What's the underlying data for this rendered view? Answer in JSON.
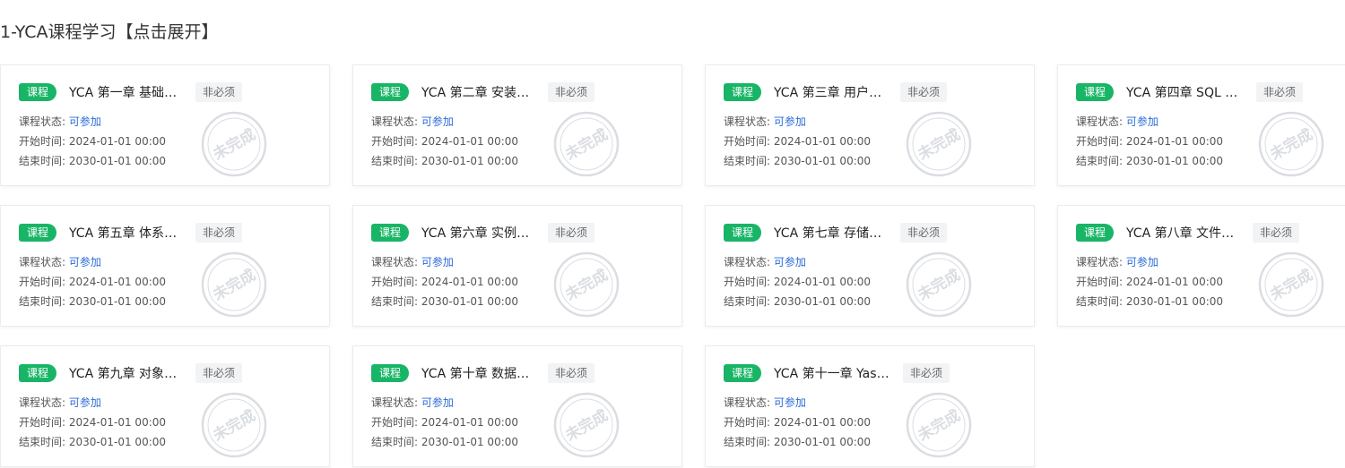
{
  "section": {
    "title": "1-YCA课程学习【点击展开】"
  },
  "labels": {
    "course_tag": "课程",
    "optional_tag": "非必须",
    "status_label": "课程状态:",
    "status_value": "可参加",
    "start_label": "开始时间:",
    "end_label": "结束时间:",
    "stamp_text": "未完成"
  },
  "colors": {
    "course_tag_bg": "#18b566",
    "status_value": "#2a6ad8",
    "stamp": "#dadde2"
  },
  "cards": [
    {
      "title": "YCA 第一章 基础介绍",
      "start": "2024-01-01 00:00",
      "end": "2030-01-01 00:00"
    },
    {
      "title": "YCA 第二章 安装部署",
      "start": "2024-01-01 00:00",
      "end": "2030-01-01 00:00"
    },
    {
      "title": "YCA 第三章 用户管理",
      "start": "2024-01-01 00:00",
      "end": "2030-01-01 00:00"
    },
    {
      "title": "YCA 第四章 SQL 语…",
      "start": "2024-01-01 00:00",
      "end": "2030-01-01 00:00"
    },
    {
      "title": "YCA 第五章 体系结构",
      "start": "2024-01-01 00:00",
      "end": "2030-01-01 00:00"
    },
    {
      "title": "YCA 第六章 实例管理",
      "start": "2024-01-01 00:00",
      "end": "2030-01-01 00:00"
    },
    {
      "title": "YCA 第七章 存储管理",
      "start": "2024-01-01 00:00",
      "end": "2030-01-01 00:00"
    },
    {
      "title": "YCA 第八章 文件管理",
      "start": "2024-01-01 00:00",
      "end": "2030-01-01 00:00"
    },
    {
      "title": "YCA 第九章 对象管理",
      "start": "2024-01-01 00:00",
      "end": "2030-01-01 00:00"
    },
    {
      "title": "YCA 第十章 数据字…",
      "start": "2024-01-01 00:00",
      "end": "2030-01-01 00:00"
    },
    {
      "title": "YCA 第十一章 Yash…",
      "start": "2024-01-01 00:00",
      "end": "2030-01-01 00:00"
    }
  ]
}
